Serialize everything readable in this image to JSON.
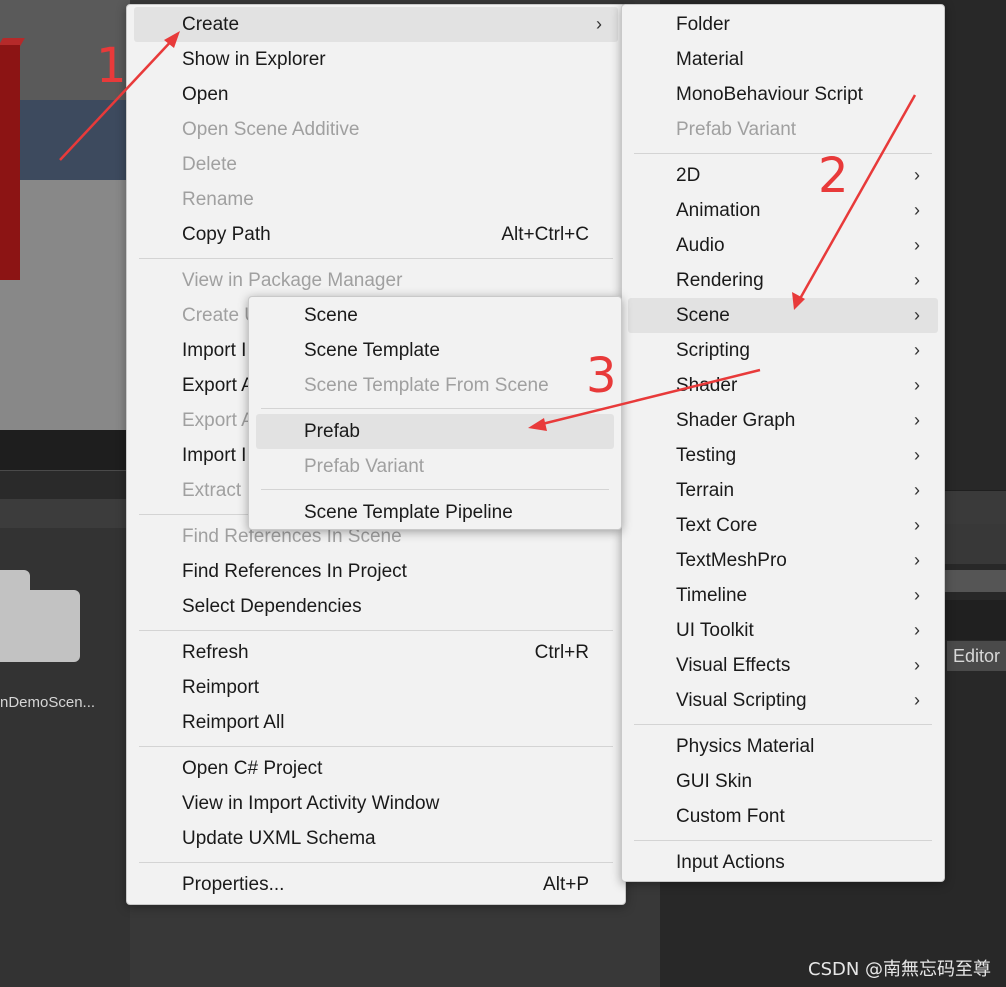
{
  "background": {
    "asset_label": "nDemoScen...",
    "editor_button": "Editor",
    "watermark": "CSDN @南無忘码至尊"
  },
  "menu_main": {
    "items": [
      {
        "label": "Create",
        "enabled": true,
        "submenu": true,
        "highlighted": true
      },
      {
        "label": "Show in Explorer",
        "enabled": true
      },
      {
        "label": "Open",
        "enabled": true
      },
      {
        "label": "Open Scene Additive",
        "enabled": false
      },
      {
        "label": "Delete",
        "enabled": false
      },
      {
        "label": "Rename",
        "enabled": false
      },
      {
        "label": "Copy Path",
        "enabled": true,
        "shortcut": "Alt+Ctrl+C"
      },
      {
        "label": "View in Package Manager",
        "enabled": false
      },
      {
        "label": "Create U",
        "enabled": false
      },
      {
        "label": "Import I",
        "enabled": true
      },
      {
        "label": "Export A",
        "enabled": true
      },
      {
        "label": "Export A",
        "enabled": false
      },
      {
        "label": "Import I",
        "enabled": true
      },
      {
        "label": "Extract",
        "enabled": false
      },
      {
        "label": "Find References In Scene",
        "enabled": false
      },
      {
        "label": "Find References In Project",
        "enabled": true
      },
      {
        "label": "Select Dependencies",
        "enabled": true
      },
      {
        "label": "Refresh",
        "enabled": true,
        "shortcut": "Ctrl+R"
      },
      {
        "label": "Reimport",
        "enabled": true
      },
      {
        "label": "Reimport All",
        "enabled": true
      },
      {
        "label": "Open C# Project",
        "enabled": true
      },
      {
        "label": "View in Import Activity Window",
        "enabled": true
      },
      {
        "label": "Update UXML Schema",
        "enabled": true
      },
      {
        "label": "Properties...",
        "enabled": true,
        "shortcut": "Alt+P"
      }
    ]
  },
  "menu_create": {
    "items": [
      {
        "label": "Folder",
        "enabled": true
      },
      {
        "label": "Material",
        "enabled": true
      },
      {
        "label": "MonoBehaviour Script",
        "enabled": true
      },
      {
        "label": "Prefab Variant",
        "enabled": false
      },
      {
        "label": "2D",
        "enabled": true,
        "submenu": true
      },
      {
        "label": "Animation",
        "enabled": true,
        "submenu": true
      },
      {
        "label": "Audio",
        "enabled": true,
        "submenu": true
      },
      {
        "label": "Rendering",
        "enabled": true,
        "submenu": true
      },
      {
        "label": "Scene",
        "enabled": true,
        "submenu": true,
        "highlighted": true
      },
      {
        "label": "Scripting",
        "enabled": true,
        "submenu": true
      },
      {
        "label": "Shader",
        "enabled": true,
        "submenu": true
      },
      {
        "label": "Shader Graph",
        "enabled": true,
        "submenu": true
      },
      {
        "label": "Testing",
        "enabled": true,
        "submenu": true
      },
      {
        "label": "Terrain",
        "enabled": true,
        "submenu": true
      },
      {
        "label": "Text Core",
        "enabled": true,
        "submenu": true
      },
      {
        "label": "TextMeshPro",
        "enabled": true,
        "submenu": true
      },
      {
        "label": "Timeline",
        "enabled": true,
        "submenu": true
      },
      {
        "label": "UI Toolkit",
        "enabled": true,
        "submenu": true
      },
      {
        "label": "Visual Effects",
        "enabled": true,
        "submenu": true
      },
      {
        "label": "Visual Scripting",
        "enabled": true,
        "submenu": true
      },
      {
        "label": "Physics Material",
        "enabled": true
      },
      {
        "label": "GUI Skin",
        "enabled": true
      },
      {
        "label": "Custom Font",
        "enabled": true
      },
      {
        "label": "Input Actions",
        "enabled": true
      }
    ]
  },
  "menu_scene": {
    "items": [
      {
        "label": "Scene",
        "enabled": true
      },
      {
        "label": "Scene Template",
        "enabled": true
      },
      {
        "label": "Scene Template From Scene",
        "enabled": false
      },
      {
        "label": "Prefab",
        "enabled": true,
        "highlighted": true
      },
      {
        "label": "Prefab Variant",
        "enabled": false
      },
      {
        "label": "Scene Template Pipeline",
        "enabled": true
      }
    ]
  },
  "annotations": {
    "color": "#e83a3a",
    "steps": [
      "1",
      "2",
      "3"
    ]
  }
}
